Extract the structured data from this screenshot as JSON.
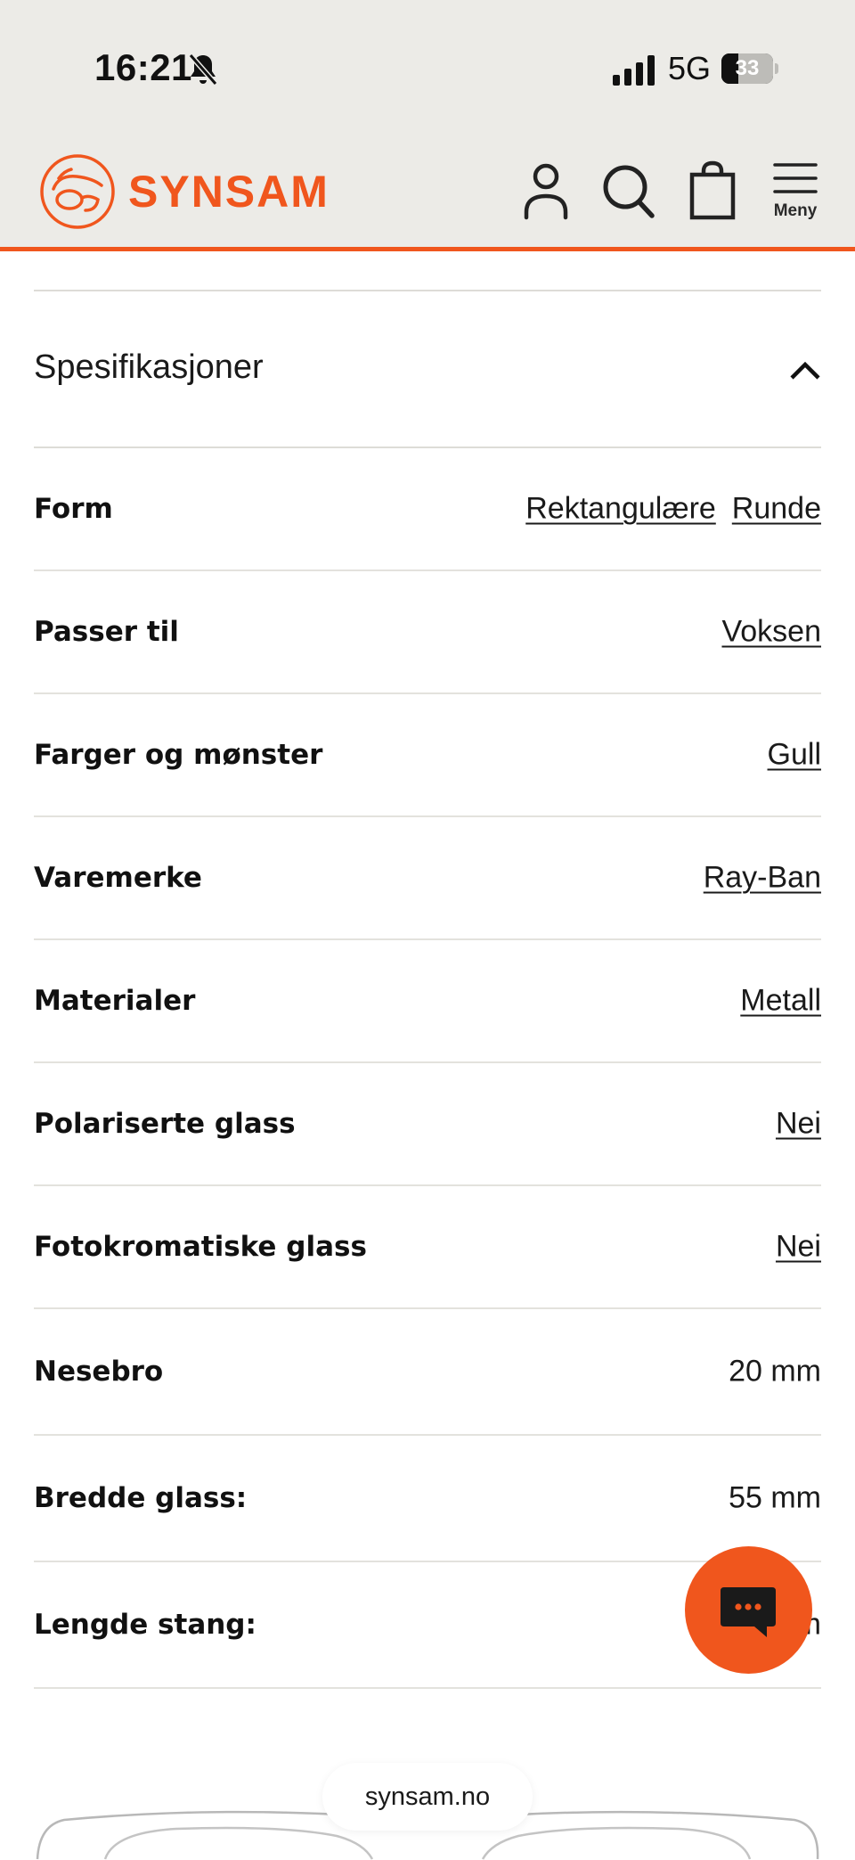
{
  "status_bar": {
    "time": "16:21",
    "network": "5G",
    "battery_percent": 33,
    "battery_label": "33"
  },
  "header": {
    "logo_text": "SYNSAM",
    "menu_label": "Meny",
    "brand_color": "#f0561d",
    "icons": [
      "account-icon",
      "search-icon",
      "bag-icon",
      "menu-icon"
    ]
  },
  "specifications": {
    "title": "Spesifikasjoner",
    "expanded": true,
    "rows": [
      {
        "label": "Form",
        "values": [
          "Rektangulære",
          "Runde"
        ],
        "linked": true
      },
      {
        "label": "Passer til",
        "values": [
          "Voksen"
        ],
        "linked": true
      },
      {
        "label": "Farger og mønster",
        "values": [
          "Gull"
        ],
        "linked": true
      },
      {
        "label": "Varemerke",
        "values": [
          "Ray-Ban"
        ],
        "linked": true
      },
      {
        "label": "Materialer",
        "values": [
          "Metall"
        ],
        "linked": true
      },
      {
        "label": "Polariserte glass",
        "values": [
          "Nei"
        ],
        "linked": true
      },
      {
        "label": "Fotokromatiske glass",
        "values": [
          "Nei"
        ],
        "linked": true
      },
      {
        "label": "Nesebro",
        "values": [
          "20 mm"
        ],
        "linked": false
      },
      {
        "label": "Bredde glass:",
        "values": [
          "55 mm"
        ],
        "linked": false
      },
      {
        "label": "Lengde stang:",
        "values": [
          "145 mm"
        ],
        "linked": false
      }
    ]
  },
  "browser": {
    "url": "synsam.no"
  },
  "colors": {
    "header_bg": "#ecebe7",
    "accent": "#f0561d",
    "divider": "#dddcd7"
  }
}
